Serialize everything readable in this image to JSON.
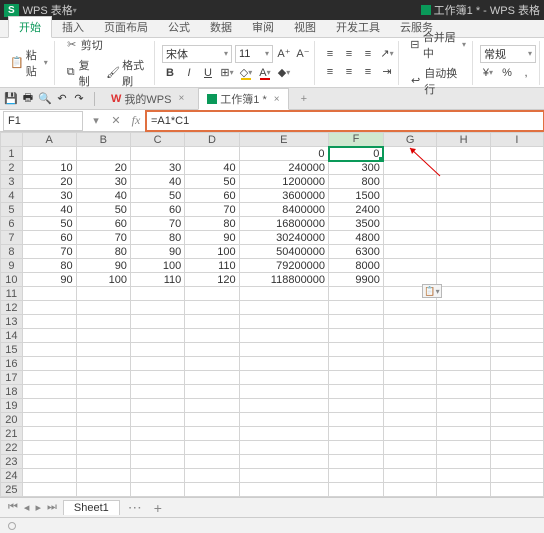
{
  "app": {
    "name": "WPS 表格",
    "doc_title": "工作簿1 * - WPS 表格"
  },
  "ribbon_tabs": [
    "开始",
    "插入",
    "页面布局",
    "公式",
    "数据",
    "审阅",
    "视图",
    "开发工具",
    "云服务"
  ],
  "ribbon_active": 0,
  "clipboard": {
    "paste": "粘贴",
    "cut": "剪切",
    "copy": "复制",
    "format_painter": "格式刷"
  },
  "font": {
    "name": "宋体",
    "size": "11"
  },
  "align": {
    "merge": "合并居中",
    "wrap": "自动换行",
    "general": "常规"
  },
  "doc_tabs": {
    "my_wps": "我的WPS",
    "workbook": "工作簿1 *"
  },
  "formula_bar": {
    "name_box": "F1",
    "formula": "=A1*C1"
  },
  "columns": [
    "A",
    "B",
    "C",
    "D",
    "E",
    "F",
    "G",
    "H",
    "I"
  ],
  "rows": [
    {
      "r": 1,
      "A": "",
      "B": "",
      "C": "",
      "D": "",
      "E": "0",
      "F": "0"
    },
    {
      "r": 2,
      "A": "10",
      "B": "20",
      "C": "30",
      "D": "40",
      "E": "240000",
      "F": "300"
    },
    {
      "r": 3,
      "A": "20",
      "B": "30",
      "C": "40",
      "D": "50",
      "E": "1200000",
      "F": "800"
    },
    {
      "r": 4,
      "A": "30",
      "B": "40",
      "C": "50",
      "D": "60",
      "E": "3600000",
      "F": "1500"
    },
    {
      "r": 5,
      "A": "40",
      "B": "50",
      "C": "60",
      "D": "70",
      "E": "8400000",
      "F": "2400"
    },
    {
      "r": 6,
      "A": "50",
      "B": "60",
      "C": "70",
      "D": "80",
      "E": "16800000",
      "F": "3500"
    },
    {
      "r": 7,
      "A": "60",
      "B": "70",
      "C": "80",
      "D": "90",
      "E": "30240000",
      "F": "4800"
    },
    {
      "r": 8,
      "A": "70",
      "B": "80",
      "C": "90",
      "D": "100",
      "E": "50400000",
      "F": "6300"
    },
    {
      "r": 9,
      "A": "80",
      "B": "90",
      "C": "100",
      "D": "110",
      "E": "79200000",
      "F": "8000"
    },
    {
      "r": 10,
      "A": "90",
      "B": "100",
      "C": "110",
      "D": "120",
      "E": "118800000",
      "F": "9900"
    }
  ],
  "empty_rows_to": 27,
  "selected": {
    "row": 1,
    "col": "F"
  },
  "sheets": {
    "active": "Sheet1"
  },
  "chart_data": {
    "type": "table",
    "columns": [
      "A",
      "B",
      "C",
      "D",
      "E",
      "F"
    ],
    "rows": [
      [
        null,
        null,
        null,
        null,
        0,
        0
      ],
      [
        10,
        20,
        30,
        40,
        240000,
        300
      ],
      [
        20,
        30,
        40,
        50,
        1200000,
        800
      ],
      [
        30,
        40,
        50,
        60,
        3600000,
        1500
      ],
      [
        40,
        50,
        60,
        70,
        8400000,
        2400
      ],
      [
        50,
        60,
        70,
        80,
        16800000,
        3500
      ],
      [
        60,
        70,
        80,
        90,
        30240000,
        4800
      ],
      [
        70,
        80,
        90,
        100,
        50400000,
        6300
      ],
      [
        80,
        90,
        100,
        110,
        79200000,
        8000
      ],
      [
        90,
        100,
        110,
        120,
        118800000,
        9900
      ]
    ],
    "formula": "F = A * C"
  }
}
